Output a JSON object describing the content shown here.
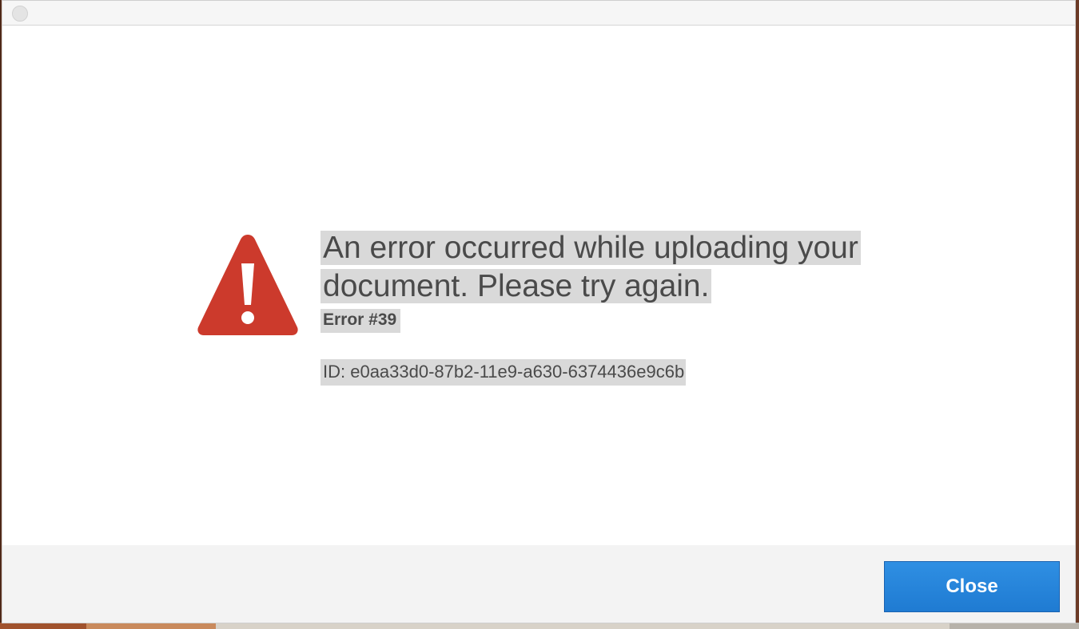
{
  "dialog": {
    "headline": "An error occurred while uploading your document. Please try again.",
    "error_code": "Error #39",
    "error_id": "ID: e0aa33d0-87b2-11e9-a630-6374436e9c6b",
    "icon": "warning-icon",
    "icon_color": "#cc3a2c"
  },
  "footer": {
    "close_label": "Close",
    "button_color": "#2584d8"
  }
}
